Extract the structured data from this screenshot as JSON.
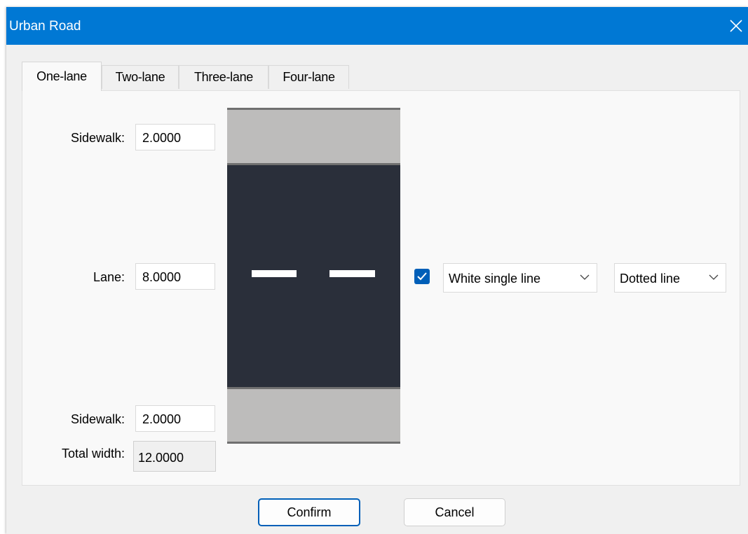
{
  "window": {
    "title": "Urban Road"
  },
  "tabs": [
    {
      "label": "One-lane",
      "active": true
    },
    {
      "label": "Two-lane",
      "active": false
    },
    {
      "label": "Three-lane",
      "active": false
    },
    {
      "label": "Four-lane",
      "active": false
    }
  ],
  "form": {
    "sidewalk_top": {
      "label": "Sidewalk:",
      "value": "2.0000"
    },
    "lane": {
      "label": "Lane:",
      "value": "8.0000"
    },
    "sidewalk_bottom": {
      "label": "Sidewalk:",
      "value": "2.0000"
    },
    "total_width": {
      "label": "Total width:",
      "value": "12.0000"
    }
  },
  "lane_marking": {
    "enabled": true,
    "color_option": "White single line",
    "style_option": "Dotted line"
  },
  "buttons": {
    "confirm": "Confirm",
    "cancel": "Cancel"
  },
  "colors": {
    "accent": "#0078d4",
    "checkbox": "#005fb8",
    "asphalt": "#2a2f3a",
    "sidewalk": "#bdbcbb",
    "marking": "#ffffff"
  }
}
